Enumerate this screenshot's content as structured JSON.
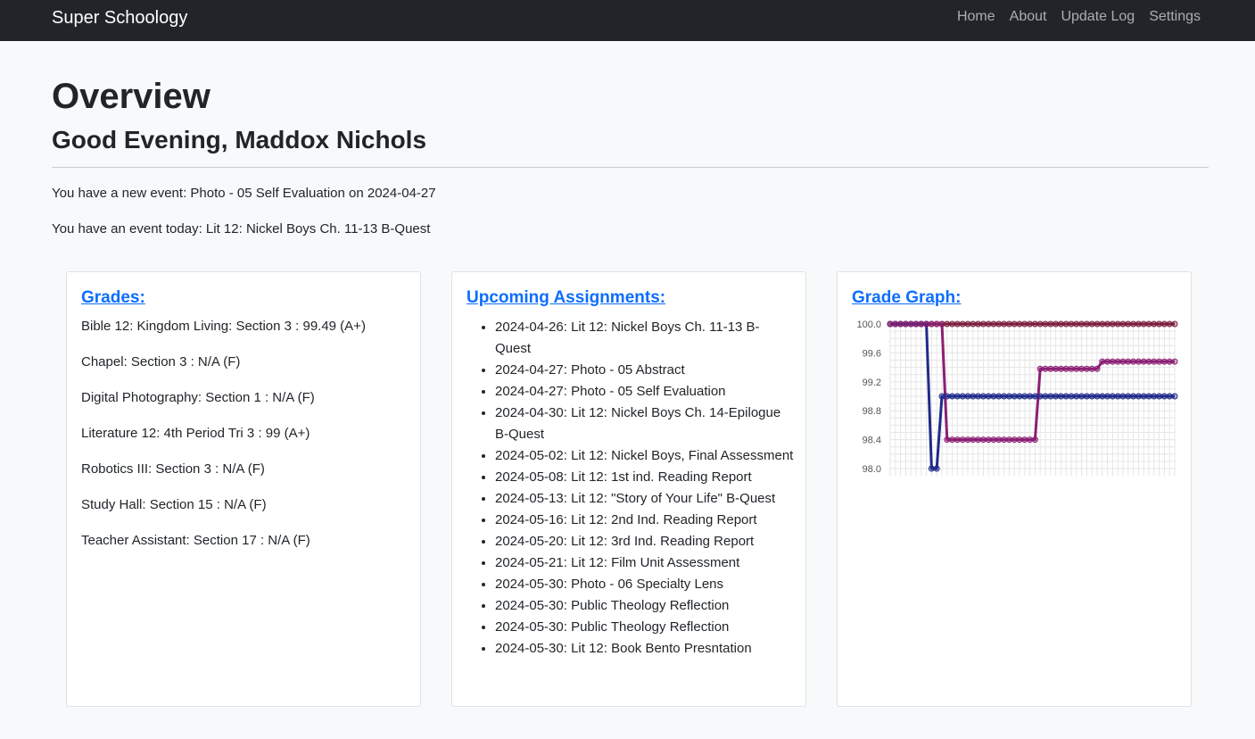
{
  "nav": {
    "brand": "Super Schoology",
    "links": [
      "Home",
      "About",
      "Update Log",
      "Settings"
    ]
  },
  "page": {
    "title": "Overview",
    "greeting": "Good Evening, Maddox Nichols",
    "events": [
      "You have a new event: Photo - 05 Self Evaluation on 2024-04-27",
      "You have an event today: Lit 12: Nickel Boys Ch. 11-13 B-Quest"
    ]
  },
  "grades": {
    "title": "Grades:",
    "items": [
      "Bible 12: Kingdom Living: Section 3 : 99.49 (A+)",
      "Chapel: Section 3 : N/A (F)",
      "Digital Photography: Section 1 : N/A (F)",
      "Literature 12: 4th Period Tri 3 : 99 (A+)",
      "Robotics III: Section 3 : N/A (F)",
      "Study Hall: Section 15 : N/A (F)",
      "Teacher Assistant: Section 17 : N/A (F)"
    ]
  },
  "assignments": {
    "title": "Upcoming Assignments:",
    "items": [
      "2024-04-26: Lit 12: Nickel Boys Ch. 11-13 B-Quest",
      "2024-04-27: Photo - 05 Abstract",
      "2024-04-27: Photo - 05 Self Evaluation",
      "2024-04-30: Lit 12: Nickel Boys Ch. 14-Epilogue B-Quest",
      "2024-05-02: Lit 12: Nickel Boys, Final Assessment",
      "2024-05-08: Lit 12: 1st ind. Reading Report",
      "2024-05-13: Lit 12: \"Story of Your Life\" B-Quest",
      "2024-05-16: Lit 12: 2nd Ind. Reading Report",
      "2024-05-20: Lit 12: 3rd Ind. Reading Report",
      "2024-05-21: Lit 12: Film Unit Assessment",
      "2024-05-30: Photo - 06 Specialty Lens",
      "2024-05-30: Public Theology Reflection",
      "2024-05-30: Public Theology Reflection",
      "2024-05-30: Lit 12: Book Bento Presntation"
    ]
  },
  "graph": {
    "title": "Grade Graph:"
  },
  "colors": {
    "navbar": "#212529",
    "link": "#0d6efd",
    "series_top": "#7a1f3d",
    "series_blue": "#1f2a8a",
    "series_purple": "#8b1f73"
  },
  "chart_data": {
    "type": "line",
    "yticks": [
      "100.0",
      "99.6",
      "99.2",
      "98.8",
      "98.4",
      "98.0"
    ],
    "ylim": [
      98.0,
      100.0
    ],
    "grid": true,
    "legend": "none",
    "point_count": 56,
    "series": [
      {
        "color": "#7a1f3d",
        "segments": [
          [
            0,
            55,
            100.0
          ]
        ]
      },
      {
        "color": "#1f2a8a",
        "segments": [
          [
            0,
            7,
            100.0
          ],
          [
            8,
            9,
            98.0
          ],
          [
            10,
            55,
            99.0
          ]
        ]
      },
      {
        "color": "#8b1f73",
        "segments": [
          [
            0,
            10,
            100.0
          ],
          [
            11,
            28,
            98.4
          ],
          [
            29,
            40,
            99.38
          ],
          [
            41,
            55,
            99.48
          ]
        ]
      }
    ]
  }
}
